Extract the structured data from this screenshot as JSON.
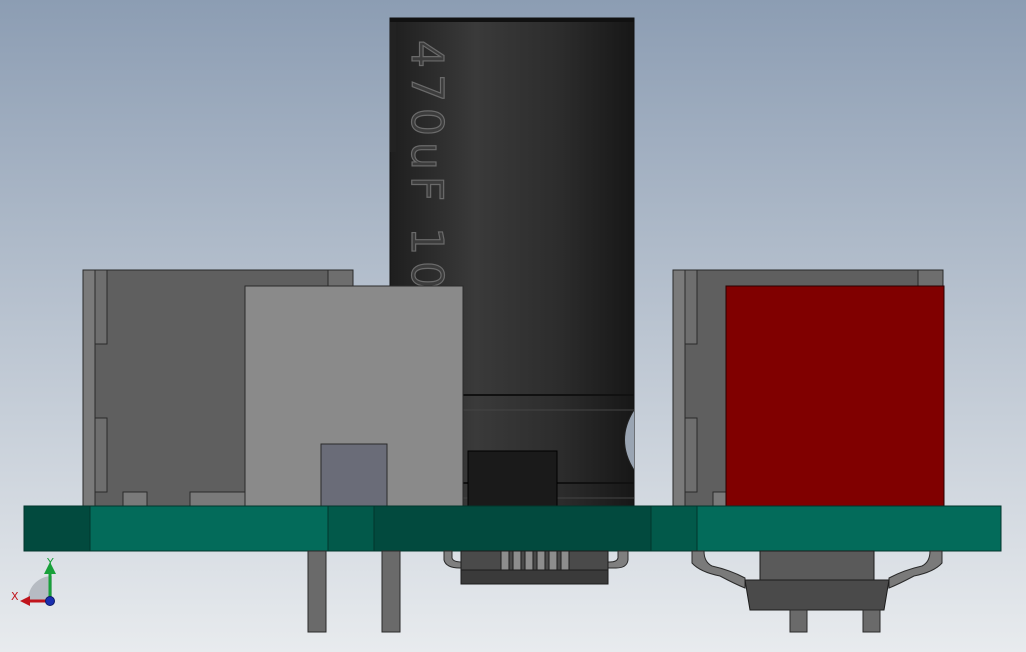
{
  "viewport": {
    "background_top": "#8c9db3",
    "background_bottom": "#e8ebee"
  },
  "capacitor": {
    "label": "470uF 10V",
    "body_color": "#2b2b2b"
  },
  "pcb": {
    "color": "#036b5a",
    "dark_color": "#024a3e"
  },
  "component_colors": {
    "red_block": "#800000",
    "gray_block": "#8a8a8a",
    "dark_gray_block": "#5f5f5f",
    "slate_block": "#6a6c78",
    "black_ic": "#1a1a1a"
  },
  "triad": {
    "x_label": "X",
    "y_label": "Y",
    "x_color": "#c0141c",
    "y_color": "#18a03a",
    "z_color": "#1a2fb0"
  }
}
